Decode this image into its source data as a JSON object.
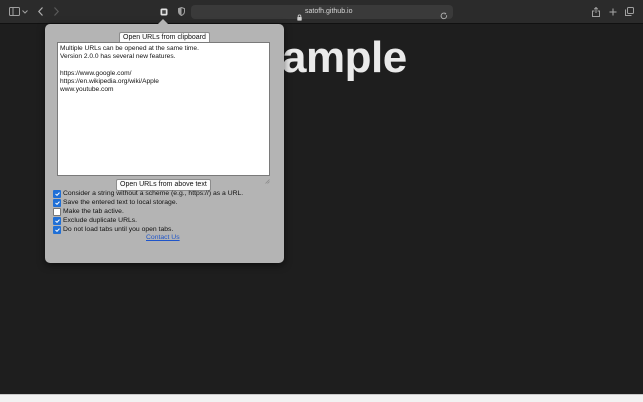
{
  "browser": {
    "address": "satofh.github.io",
    "icons": [
      "sidebar-icon",
      "chevron-down-icon",
      "back-icon",
      "forward-icon",
      "extension-icon",
      "shield-icon",
      "lock-icon",
      "reload-icon",
      "share-icon",
      "plus-icon",
      "tabs-icon"
    ]
  },
  "page": {
    "heading": "ample"
  },
  "popup": {
    "open_clipboard_label": "Open URLs from clipboard",
    "textarea_value": "Multiple URLs can be opened at the same time.\nVersion 2.0.0 has several new features.\n\nhttps://www.google.com/\nhttps://en.wikipedia.org/wiki/Apple\nwww.youtube.com",
    "open_text_label": "Open URLs from above text",
    "options": [
      {
        "label": "Consider a string without a scheme (e.g., https://) as a URL.",
        "checked": true
      },
      {
        "label": "Save the entered text to local storage.",
        "checked": true
      },
      {
        "label": "Make the tab active.",
        "checked": false
      },
      {
        "label": "Exclude duplicate URLs.",
        "checked": true
      },
      {
        "label": "Do not load tabs until you open tabs.",
        "checked": true
      }
    ],
    "contact_label": "Contact Us"
  },
  "colors": {
    "background": "#1e1e1e",
    "popup": "#b4b4b4",
    "checkbox": "#1f6fd6",
    "link": "#1f55c9"
  }
}
